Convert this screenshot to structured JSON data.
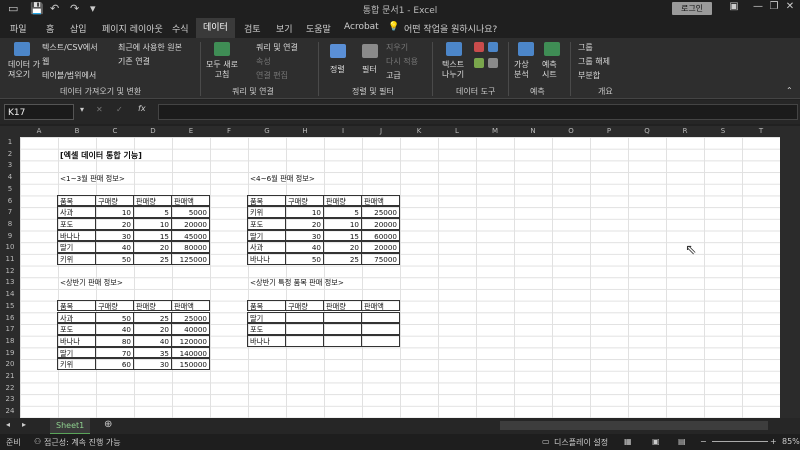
{
  "app": {
    "doc_title": "통합 문서1  -  Excel",
    "login": "로그인"
  },
  "tabs": [
    "파일",
    "홈",
    "삽입",
    "페이지 레이아웃",
    "수식",
    "데이터",
    "검토",
    "보기",
    "도움말",
    "Acrobat"
  ],
  "active_tab": "데이터",
  "tell_me": "어떤 작업을 원하시나요?",
  "ribbon": {
    "get_data": "데이터 가\n져오기",
    "text_csv": "텍스트/CSV에서",
    "web": "웹",
    "table_range": "테이블/범위에서",
    "recent_sources": "최근에 사용한 원본",
    "existing_conn": "기존 연결",
    "group1": "데이터 가져오기 및 변환",
    "refresh_all": "모두 새로\n고침",
    "queries_conn": "쿼리 및 연결",
    "properties": "속성",
    "edit_links": "연결 편집",
    "group2": "쿼리 및 연결",
    "sort": "정렬",
    "filter": "필터",
    "clear": "지우기",
    "reapply": "다시 적용",
    "advanced": "고급",
    "group3": "정렬 및 필터",
    "text_to_cols": "텍스트\n나누기",
    "group4": "데이터 도구",
    "whatif": "가상\n분석",
    "forecast": "예측\n시트",
    "group5": "예측",
    "grp": "그룹",
    "ungrp": "그룹 해제",
    "subtotal": "부분합",
    "group6": "개요"
  },
  "namebox": "K17",
  "columns": [
    "A",
    "B",
    "C",
    "D",
    "E",
    "F",
    "G",
    "H",
    "I",
    "J",
    "K",
    "L",
    "M",
    "N",
    "O",
    "P",
    "Q",
    "R",
    "S",
    "T"
  ],
  "rows": [
    "1",
    "2",
    "3",
    "4",
    "5",
    "6",
    "7",
    "8",
    "9",
    "10",
    "11",
    "12",
    "13",
    "14",
    "15",
    "16",
    "17",
    "18",
    "19",
    "20",
    "21",
    "22",
    "23",
    "24"
  ],
  "sheet": {
    "title": "[엑셀 데이터 통합 기능]",
    "label_q1": "<1~3월 판매 정보>",
    "label_q2": "<4~6월 판매 정보>",
    "label_h1": "<상반기 판매 정보>",
    "label_h1_item": "<상반기 특정 품목 판매 정보>",
    "headers": [
      "품목",
      "구매량",
      "판매량",
      "판매액"
    ],
    "table_q1": [
      [
        "사과",
        "10",
        "5",
        "5000"
      ],
      [
        "포도",
        "20",
        "10",
        "20000"
      ],
      [
        "바나나",
        "30",
        "15",
        "45000"
      ],
      [
        "딸기",
        "40",
        "20",
        "80000"
      ],
      [
        "키위",
        "50",
        "25",
        "125000"
      ]
    ],
    "table_q2": [
      [
        "키위",
        "10",
        "5",
        "25000"
      ],
      [
        "포도",
        "20",
        "10",
        "20000"
      ],
      [
        "딸기",
        "30",
        "15",
        "60000"
      ],
      [
        "사과",
        "40",
        "20",
        "20000"
      ],
      [
        "바나나",
        "50",
        "25",
        "75000"
      ]
    ],
    "table_h1": [
      [
        "사과",
        "50",
        "25",
        "25000"
      ],
      [
        "포도",
        "40",
        "20",
        "40000"
      ],
      [
        "바나나",
        "80",
        "40",
        "120000"
      ],
      [
        "딸기",
        "70",
        "35",
        "140000"
      ],
      [
        "키위",
        "60",
        "30",
        "150000"
      ]
    ],
    "table_item": [
      [
        "딸기",
        "",
        "",
        ""
      ],
      [
        "포도",
        "",
        "",
        ""
      ],
      [
        "바나나",
        "",
        "",
        ""
      ]
    ]
  },
  "sheet_tab": "Sheet1",
  "status": {
    "ready": "준비",
    "accessibility": "접근성: 계속 진행 가능",
    "display_settings": "디스플레이 설정",
    "zoom": "85%"
  }
}
